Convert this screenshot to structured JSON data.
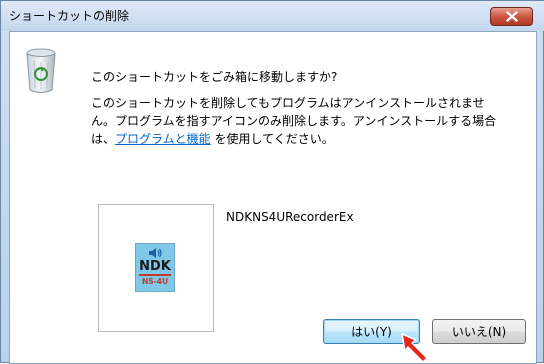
{
  "window": {
    "title": "ショートカットの削除",
    "close_label": "x"
  },
  "dialog": {
    "question": "このショートカットをごみ箱に移動しますか?",
    "body_line1": "このショートカットを削除してもプログラムはアンインストールされませ",
    "body_line2": "ん。プログラムを指すアイコンのみ削除します。アンインストールする場合",
    "body_line3_prefix": "は、",
    "body_link": "プログラムと機能",
    "body_line3_suffix": " を使用してください。"
  },
  "shortcut": {
    "name": "NDKNS4URecorderEx",
    "icon_text_main": "NDK",
    "icon_text_sub": "NS-4U"
  },
  "buttons": {
    "yes_label": "はい(Y)",
    "no_label": "いいえ(N)"
  },
  "colors": {
    "link": "#0066cc",
    "close_button": "#c7533e",
    "cursor": "#e8251b",
    "app_icon_bg": "#7fc8e8"
  },
  "icons": [
    "recycle-bin-icon",
    "ndk-app-icon",
    "speaker-icon",
    "close-icon",
    "pointer-cursor-icon"
  ]
}
